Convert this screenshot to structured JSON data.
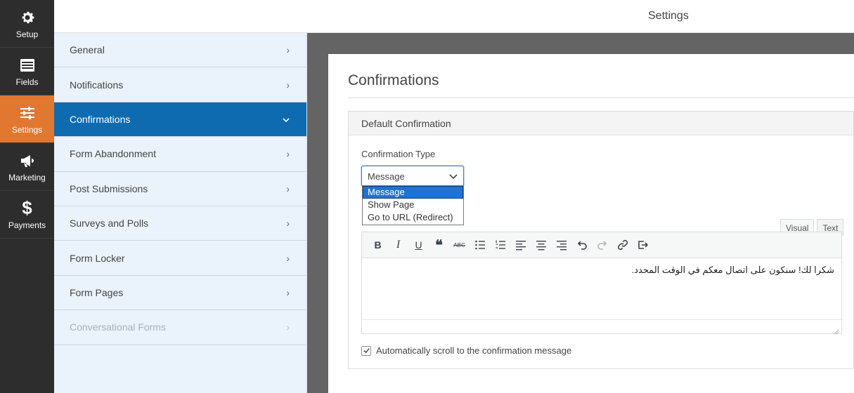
{
  "vnav": {
    "items": [
      {
        "label": "Setup",
        "icon": "gear-icon"
      },
      {
        "label": "Fields",
        "icon": "fields-icon"
      },
      {
        "label": "Settings",
        "icon": "sliders-icon"
      },
      {
        "label": "Marketing",
        "icon": "megaphone-icon"
      },
      {
        "label": "Payments",
        "icon": "dollar-icon"
      }
    ],
    "active": "Settings",
    "accent": "#e27730"
  },
  "topbar": {
    "title": "Settings"
  },
  "panels": {
    "items": [
      {
        "label": "General",
        "state": "collapsed"
      },
      {
        "label": "Notifications",
        "state": "collapsed"
      },
      {
        "label": "Confirmations",
        "state": "expanded"
      },
      {
        "label": "Form Abandonment",
        "state": "collapsed"
      },
      {
        "label": "Post Submissions",
        "state": "collapsed"
      },
      {
        "label": "Surveys and Polls",
        "state": "collapsed"
      },
      {
        "label": "Form Locker",
        "state": "collapsed"
      },
      {
        "label": "Form Pages",
        "state": "collapsed"
      },
      {
        "label": "Conversational Forms",
        "state": "disabled"
      }
    ],
    "active_color": "#0e6bb0"
  },
  "content": {
    "section_title": "Confirmations",
    "box_title": "Default Confirmation",
    "confirmation_type": {
      "label": "Confirmation Type",
      "selected": "Message",
      "options": [
        "Message",
        "Show Page",
        "Go to URL (Redirect)"
      ]
    },
    "editor": {
      "tabs": [
        "Visual",
        "Text"
      ],
      "active_tab": "Visual",
      "toolbar": [
        "bold-icon",
        "italic-icon",
        "underline-icon",
        "blockquote-icon",
        "strikethrough-icon",
        "bullet-list-icon",
        "numbered-list-icon",
        "align-left-icon",
        "align-center-icon",
        "align-right-icon",
        "undo-icon",
        "redo-icon",
        "link-icon",
        "fullscreen-icon"
      ],
      "body_text": "شكرا لك! سنكون على اتصال معكم في الوقت المحدد."
    },
    "autoscroll": {
      "label": "Automatically scroll to the confirmation message",
      "checked": true
    }
  }
}
